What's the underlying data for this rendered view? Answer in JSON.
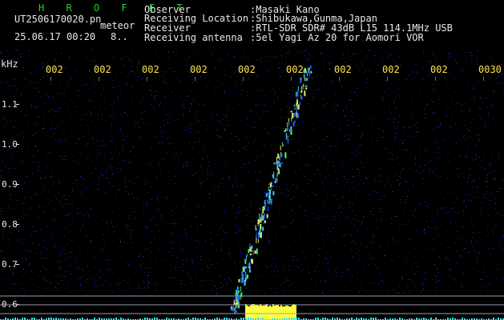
{
  "header": {
    "program": "H R O F F T",
    "filename": "UT2506170020.pn",
    "mode": "meteor",
    "datetime": "25.06.17 00:20",
    "extra": "8..",
    "fields": [
      {
        "label": "Observer",
        "value": ":Masaki Kano"
      },
      {
        "label": "Receiving Location",
        "value": ":Shibukawa,Gunma,Japan"
      },
      {
        "label": "Receiver",
        "value": ":RTL-SDR SDR# 43dB L15 114.1MHz USB"
      },
      {
        "label": "Receiving antenna",
        "value": ":5el Yagi Az 20 for Aomori VOR"
      }
    ]
  },
  "colors": {
    "background": "#000000",
    "noise": "#1a2a9a",
    "time_ticks": "#ffe24a",
    "axis_text": "#e8e8e8",
    "meteor": "#3ad2ff",
    "burst": "#ffff40",
    "baseline": "#31e6ff"
  },
  "chart_data": {
    "type": "heatmap",
    "ylabel": "kHz",
    "y_ticks": [
      "1.1",
      "1.0",
      "0.9",
      "0.8",
      "0.7",
      "0.6"
    ],
    "x_ticks": [
      "002",
      "002",
      "002",
      "002",
      "002",
      "002",
      "002",
      "002",
      "002",
      "0030"
    ],
    "meteor_trail": {
      "start_khz": 0.58,
      "end_khz": 1.2
    },
    "grid": false
  }
}
